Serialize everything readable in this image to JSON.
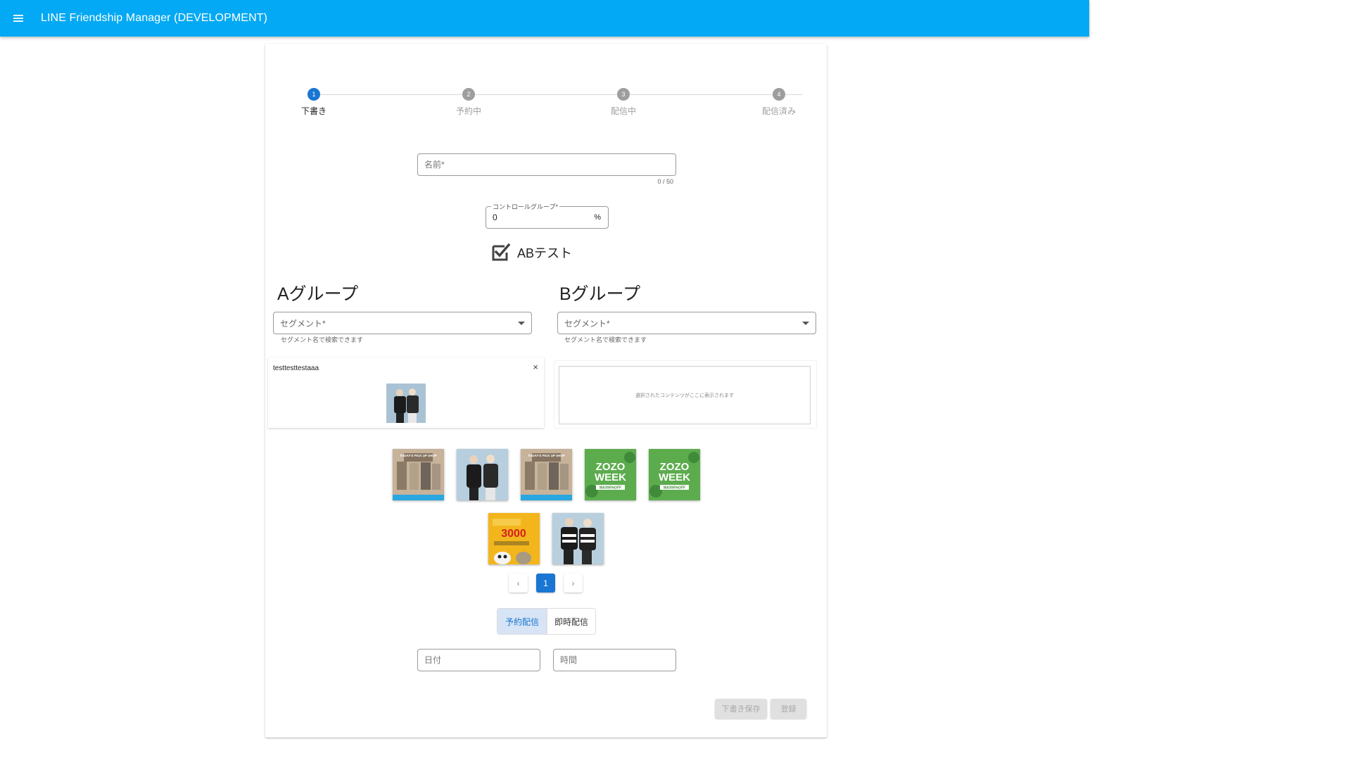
{
  "app": {
    "title": "LINE Friendship Manager (DEVELOPMENT)"
  },
  "stepper": [
    {
      "number": "1",
      "label": "下書き",
      "active": true
    },
    {
      "number": "2",
      "label": "予約中",
      "active": false
    },
    {
      "number": "3",
      "label": "配信中",
      "active": false
    },
    {
      "number": "4",
      "label": "配信済み",
      "active": false
    }
  ],
  "name_field": {
    "placeholder": "名前*",
    "value": "",
    "counter": "0 / 50"
  },
  "control_group": {
    "label": "コントロールグループ*",
    "value": "0",
    "unit": "%"
  },
  "ab_test": {
    "label": "ABテスト",
    "checked": true
  },
  "group_a": {
    "title": "Aグループ",
    "segment_placeholder": "セグメント*",
    "segment_helper": "セグメント名で検索できます",
    "content_title": "testtesttestaaa",
    "close": "×"
  },
  "group_b": {
    "title": "Bグループ",
    "segment_placeholder": "セグメント*",
    "segment_helper": "セグメント名で検索できます",
    "empty_text": "選択されたコンテンツがここに表示されます"
  },
  "thumbnails": [
    {
      "name": "today-pick-up-shop-1",
      "title_text": "TODAY'S PICK UP SHOP"
    },
    {
      "name": "jacket-couple-1"
    },
    {
      "name": "today-pick-up-shop-2",
      "title_text": "TODAY'S PICK UP SHOP"
    },
    {
      "name": "zozo-week-1",
      "title_text": "ZOZO WEEK",
      "sub_text": "MAX95%OFF"
    },
    {
      "name": "zozo-week-2",
      "title_text": "ZOZO WEEK",
      "sub_text": "MAX95%OFF"
    },
    {
      "name": "friend-invite-3000",
      "title_text": "3000"
    },
    {
      "name": "jacket-couple-2"
    }
  ],
  "pagination": {
    "prev": "‹",
    "current": "1",
    "next": "›"
  },
  "delivery": {
    "scheduled": "予約配信",
    "immediate": "即時配信"
  },
  "date_field": {
    "placeholder": "日付"
  },
  "time_field": {
    "placeholder": "時間"
  },
  "actions": {
    "save_draft": "下書き保存",
    "register": "登録"
  },
  "colors": {
    "appbar": "#03a9f4",
    "primary": "#1976d2",
    "zozo_green": "#5cac4e",
    "invite_yellow": "#f2b61c"
  }
}
